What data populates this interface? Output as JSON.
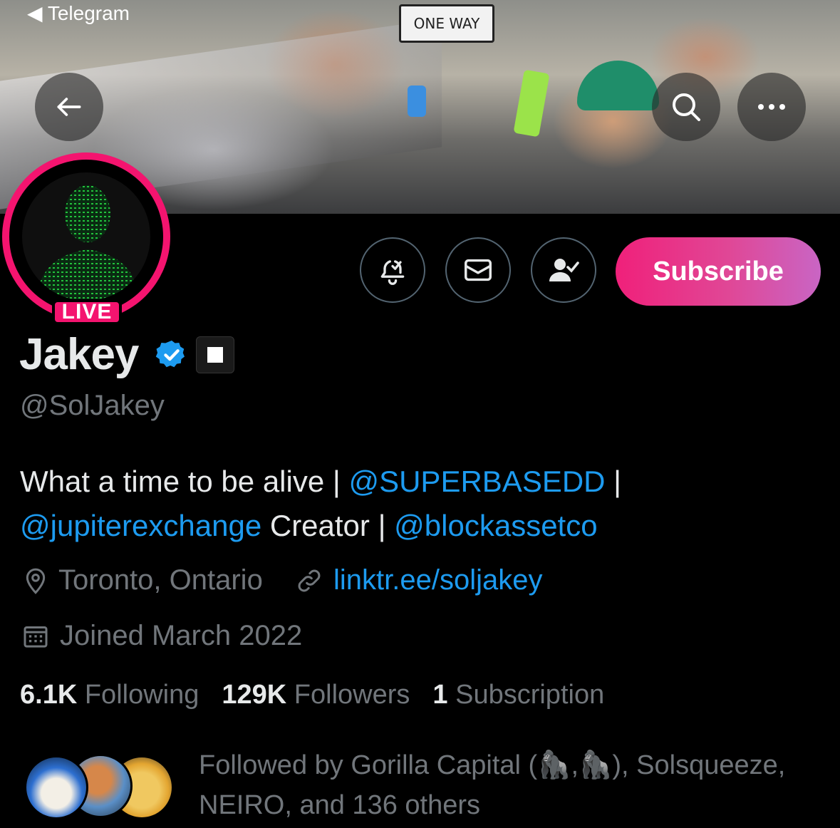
{
  "status_bar": {
    "back_app": "Telegram"
  },
  "banner": {
    "sign_text": "ONE WAY"
  },
  "live_badge": "LIVE",
  "actions": {
    "subscribe_label": "Subscribe"
  },
  "profile": {
    "name": "Jakey",
    "handle": "@SolJakey",
    "bio": {
      "part1": "What a time to be alive | ",
      "mention1": "@SUPERBASEDD",
      "part2": " |",
      "mention2": "@jupiterexchange",
      "part3": " Creator | ",
      "mention3": "@blockassetco"
    },
    "location": "Toronto, Ontario",
    "website": "linktr.ee/soljakey",
    "joined": "Joined March 2022"
  },
  "stats": {
    "following_count": "6.1K",
    "following_label": "Following",
    "followers_count": "129K",
    "followers_label": "Followers",
    "subscription_count": "1",
    "subscription_label": "Subscription"
  },
  "followed_by": {
    "line1": "Followed by Gorilla Capital (🦍,🦍), Solsqueeze,",
    "line2": "NEIRO, and 136 others"
  },
  "colors": {
    "accent": "#1d9bf0",
    "live": "#f4146f",
    "muted": "#71767b"
  }
}
